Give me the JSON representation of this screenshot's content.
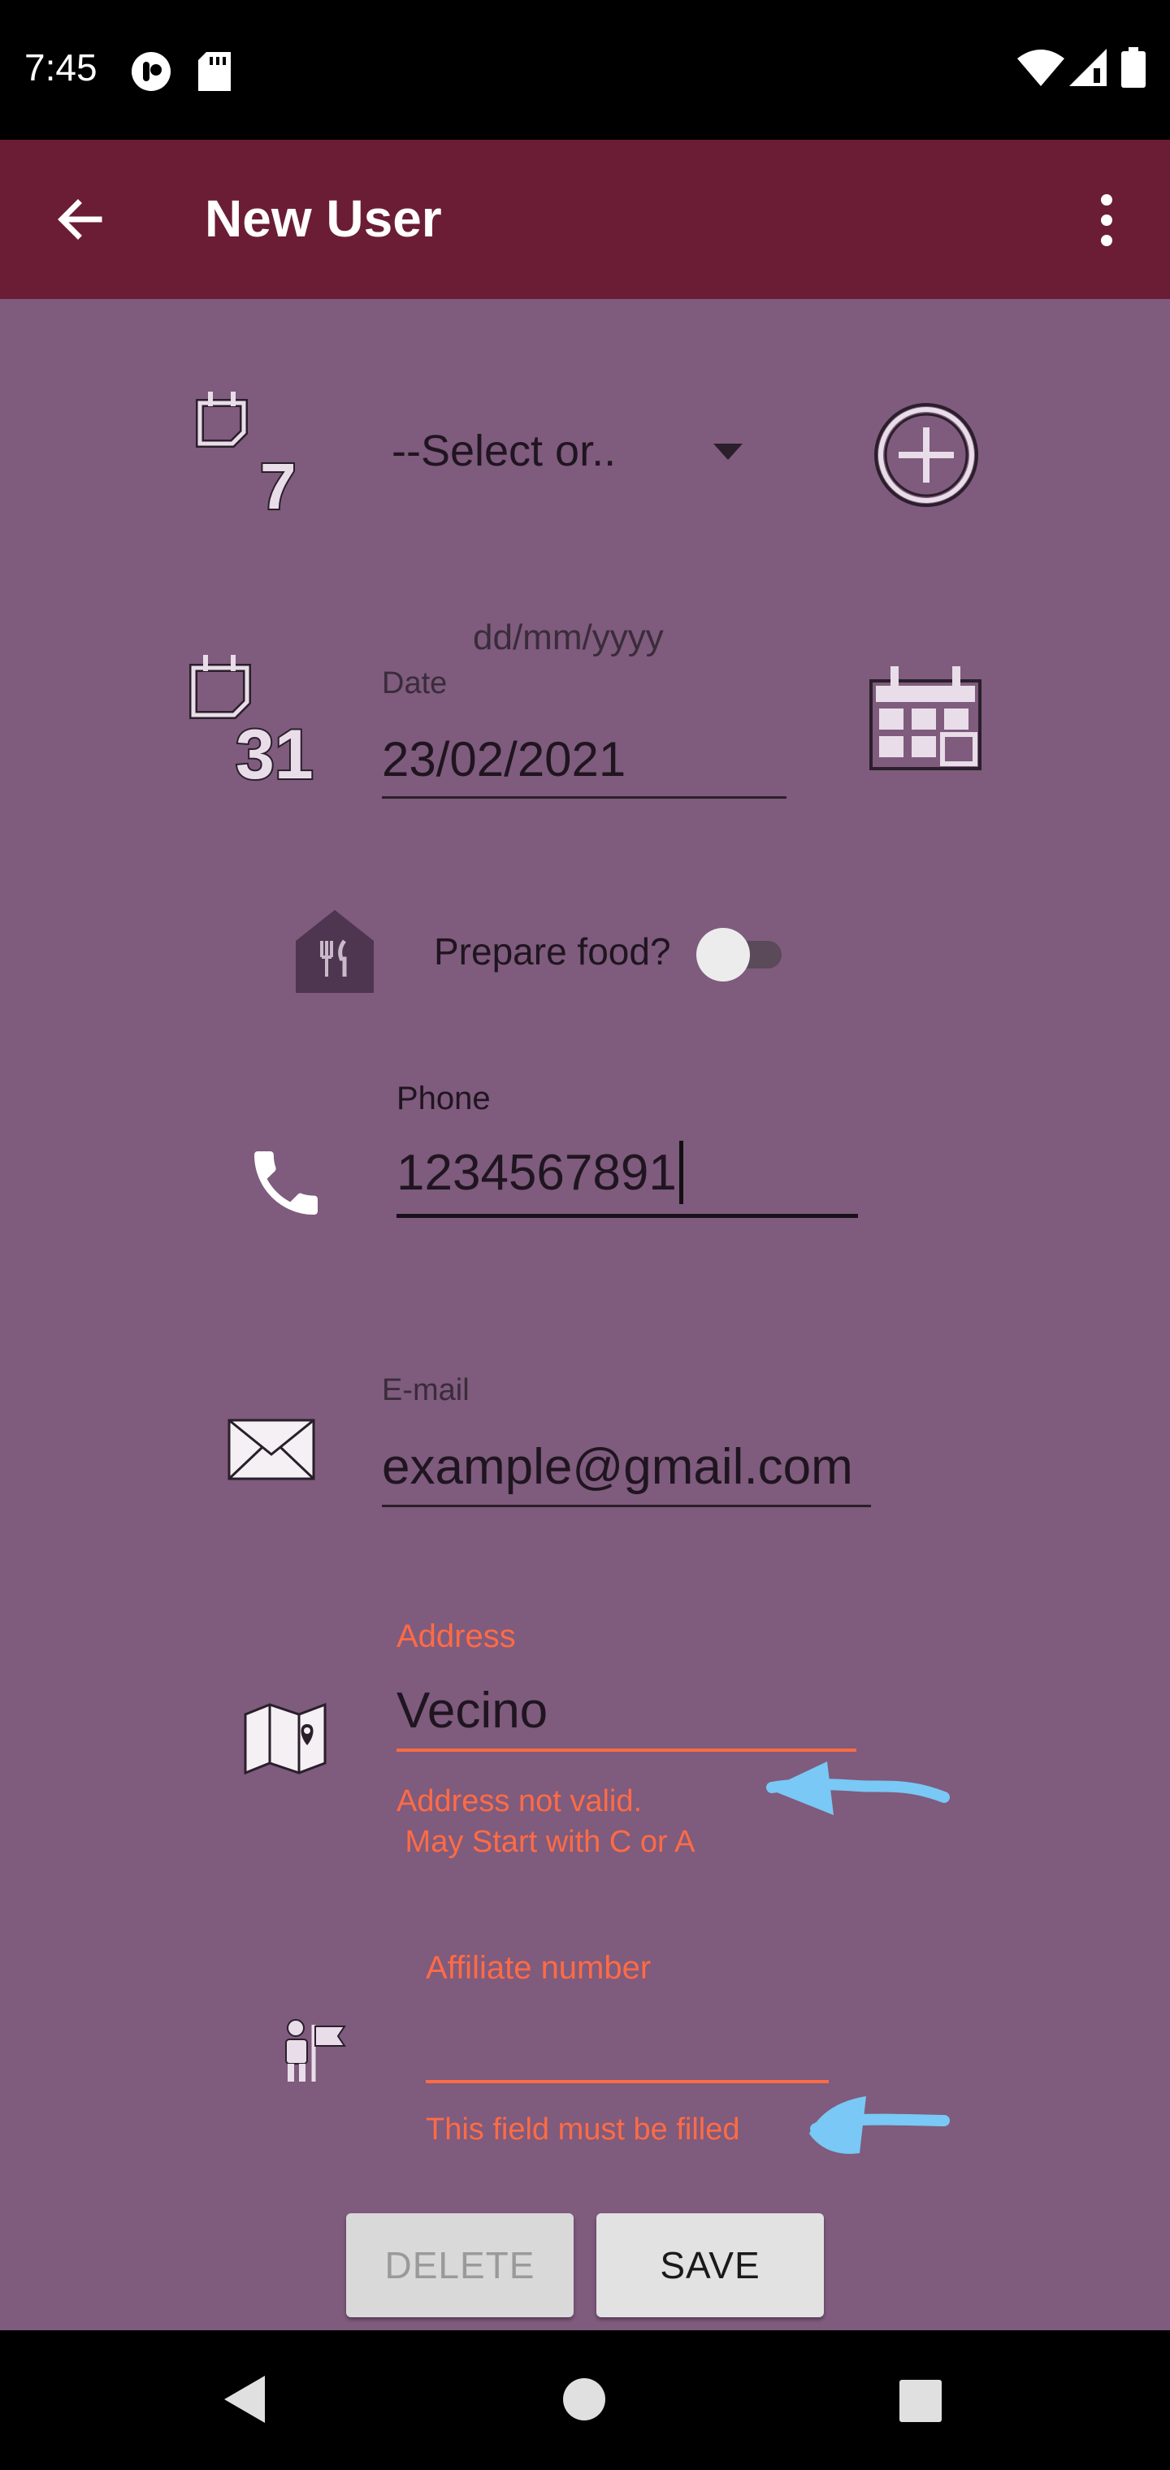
{
  "status_bar": {
    "time": "7:45"
  },
  "app_bar": {
    "title": "New User"
  },
  "form": {
    "weekday_select": {
      "value": "--Select or.."
    },
    "date": {
      "hint": "dd/mm/yyyy",
      "label": "Date",
      "value": "23/02/2021"
    },
    "food": {
      "label": "Prepare food?",
      "enabled": false
    },
    "phone": {
      "label": "Phone",
      "value": "1234567891"
    },
    "email": {
      "label": "E-mail",
      "value": "example@gmail.com"
    },
    "address": {
      "label": "Address",
      "value": "Vecino",
      "error_line1": "Address not valid.",
      "error_line2": " May Start with C or A"
    },
    "affiliate": {
      "label": "Affiliate number",
      "value": "",
      "error": "This field must be filled"
    }
  },
  "buttons": {
    "delete": "DELETE",
    "save": "SAVE"
  },
  "colors": {
    "app_bar": "#6b1d36",
    "background": "#7f5b7d",
    "error": "#ff6b45",
    "annotation_arrow": "#79c8f5"
  },
  "icons": [
    "back-arrow-icon",
    "overflow-menu-icon",
    "calendar-7-icon",
    "dropdown-arrow-icon",
    "add-circle-icon",
    "calendar-31-icon",
    "calendar-grid-icon",
    "restaurant-icon",
    "phone-icon",
    "mail-icon",
    "map-icon",
    "affiliate-flag-icon",
    "nav-back-icon",
    "nav-home-icon",
    "nav-recents-icon"
  ]
}
